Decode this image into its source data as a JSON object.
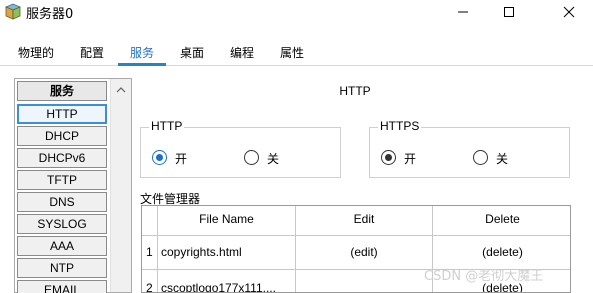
{
  "window": {
    "title": "服务器0"
  },
  "tabs": [
    {
      "label": "物理的"
    },
    {
      "label": "配置"
    },
    {
      "label": "服务"
    },
    {
      "label": "桌面"
    },
    {
      "label": "编程"
    },
    {
      "label": "属性"
    }
  ],
  "active_tab": "服务",
  "services": {
    "header": "服务",
    "items": [
      "HTTP",
      "DHCP",
      "DHCPv6",
      "TFTP",
      "DNS",
      "SYSLOG",
      "AAA",
      "NTP",
      "EMAIL"
    ],
    "selected": "HTTP"
  },
  "http_page": {
    "title": "HTTP",
    "http_group": {
      "label": "HTTP",
      "on_label": "开",
      "off_label": "关",
      "state": "on"
    },
    "https_group": {
      "label": "HTTPS",
      "on_label": "开",
      "off_label": "关",
      "state": "on"
    },
    "file_manager": {
      "label": "文件管理器",
      "columns": [
        "File Name",
        "Edit",
        "Delete"
      ],
      "rows": [
        {
          "index": "1",
          "file_name": "copyrights.html",
          "edit": "(edit)",
          "delete": "(delete)"
        },
        {
          "index": "2",
          "file_name": "cscoptlogo177x111....",
          "edit": "",
          "delete": "(delete)"
        }
      ]
    }
  },
  "watermark": "CSDN @老彻大魔王",
  "colors": {
    "accent": "#1f6fc6",
    "tab_underline": "#1f86c8"
  }
}
